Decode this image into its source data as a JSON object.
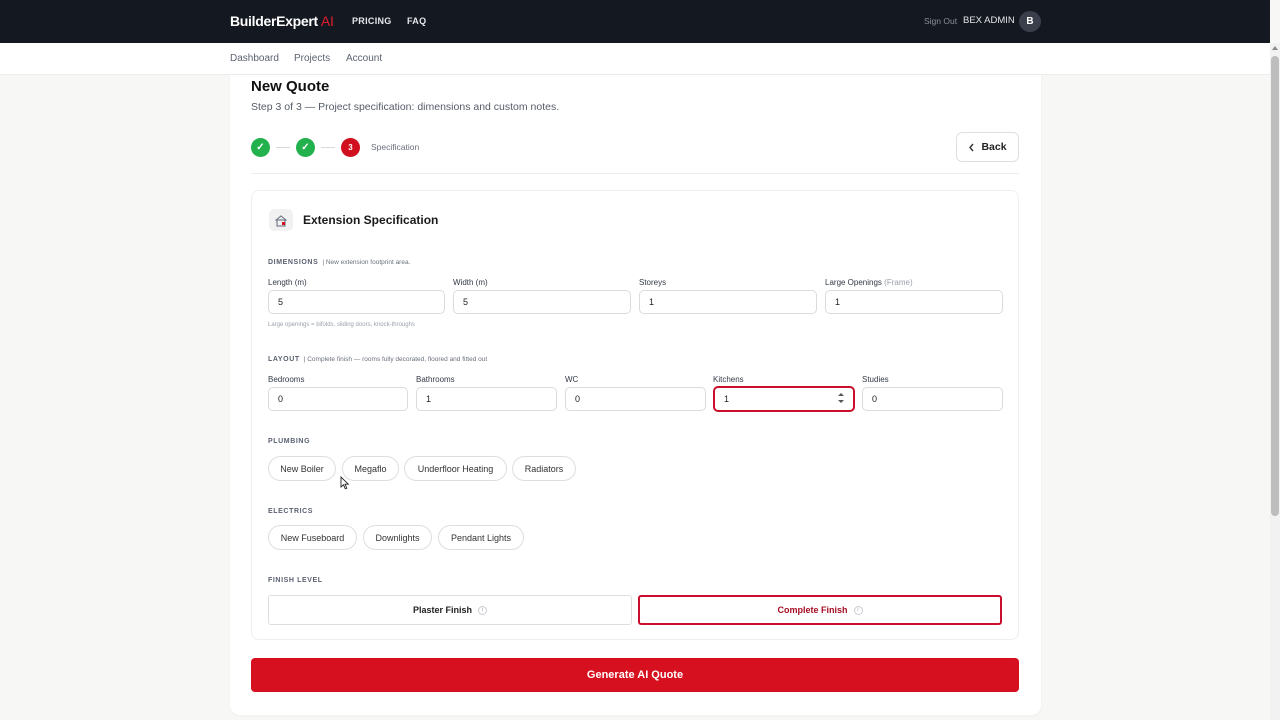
{
  "header": {
    "brand": "BuilderExpert",
    "brand_ai": "AI",
    "nav": [
      "PRICING",
      "FAQ"
    ],
    "sign_out": "Sign Out",
    "user_name": "BEX ADMIN",
    "avatar_initial": "B"
  },
  "subnav": [
    "Dashboard",
    "Projects",
    "Account"
  ],
  "page": {
    "title": "New Quote",
    "subtitle": "Step 3 of 3 — Project specification: dimensions and custom notes.",
    "steps": [
      {
        "state": "done",
        "text": "✓"
      },
      {
        "state": "done",
        "text": "✓"
      },
      {
        "state": "active",
        "text": "3",
        "label": "Specification"
      }
    ],
    "back_label": "Back"
  },
  "spec": {
    "title": "Extension Specification",
    "dimensions": {
      "label": "DIMENSIONS",
      "note": "| New extension footprint area.",
      "fields": [
        {
          "label": "Length (m)",
          "value": "5"
        },
        {
          "label": "Width (m)",
          "value": "5"
        },
        {
          "label": "Storeys",
          "value": "1"
        },
        {
          "label": "Large Openings",
          "hint": "(Frame)",
          "value": "1"
        }
      ],
      "hint": "Large openings = bifolds, sliding doors, knock-throughs"
    },
    "layout": {
      "label": "LAYOUT",
      "note": "| Complete finish — rooms fully decorated, floored and fitted out",
      "fields": [
        {
          "label": "Bedrooms",
          "value": "0"
        },
        {
          "label": "Bathrooms",
          "value": "1"
        },
        {
          "label": "WC",
          "value": "0"
        },
        {
          "label": "Kitchens",
          "value": "1"
        },
        {
          "label": "Studies",
          "value": "0"
        }
      ]
    },
    "plumbing": {
      "label": "PLUMBING",
      "options": [
        "New Boiler",
        "Megaflo",
        "Underfloor Heating",
        "Radiators"
      ]
    },
    "electrics": {
      "label": "ELECTRICS",
      "options": [
        "New Fuseboard",
        "Downlights",
        "Pendant Lights"
      ]
    },
    "finish": {
      "label": "FINISH LEVEL",
      "options": [
        "Plaster Finish",
        "Complete Finish"
      ],
      "selected": "Complete Finish",
      "info_glyph": "i"
    }
  },
  "generate_label": "Generate AI Quote",
  "colors": {
    "accent": "#d6101e",
    "success": "#22b14c",
    "topbar": "#141821"
  }
}
